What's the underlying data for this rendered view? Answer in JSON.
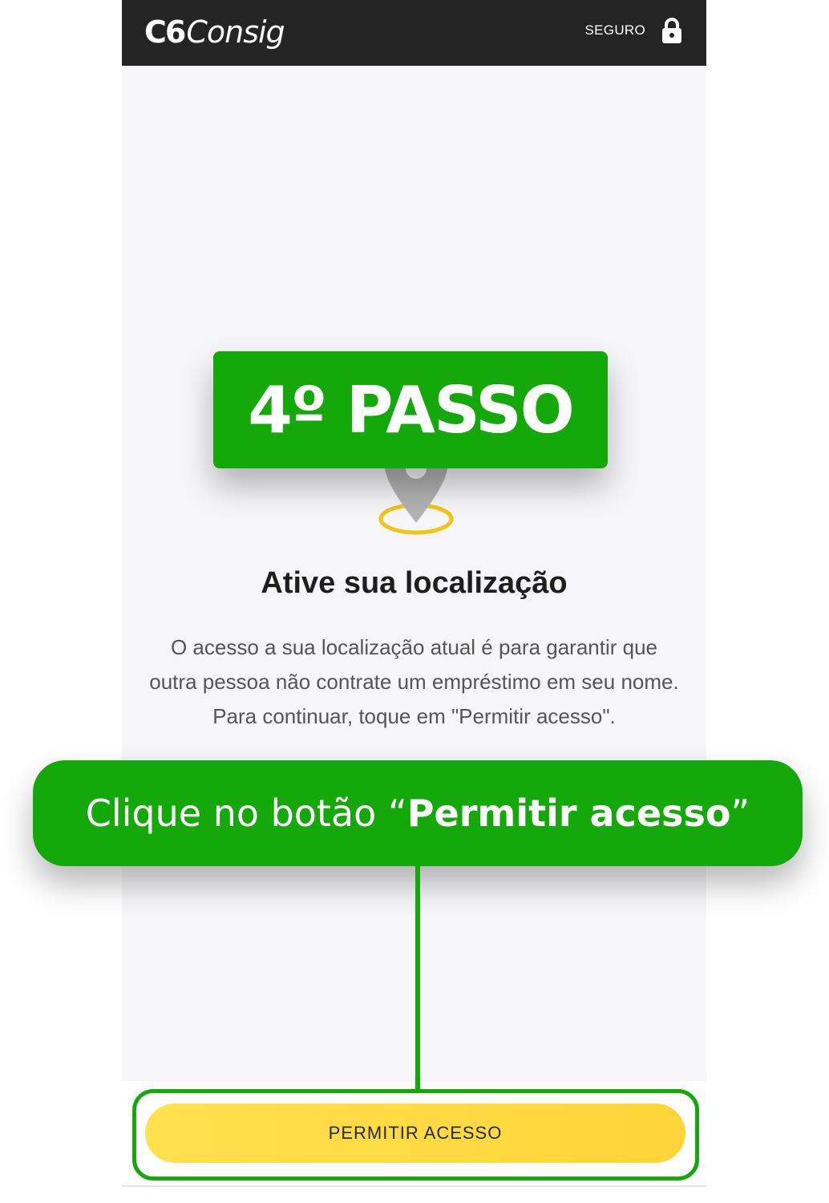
{
  "header": {
    "logo_c6": "C6",
    "logo_consig": "Consig",
    "secure_label": "SEGURO"
  },
  "main": {
    "title": "Ative sua localização",
    "description": "O acesso a sua localização atual é para garantir que outra pessoa não contrate um empréstimo em seu nome. Para continuar, toque em \"Permitir acesso\"."
  },
  "footer": {
    "button_label": "PERMITIR ACESSO"
  },
  "overlay": {
    "step_label": "4º PASSO",
    "callout_prefix": "Clique no botão ",
    "callout_quote_open": "“",
    "callout_bold": "Permitir acesso",
    "callout_quote_close": "”"
  },
  "colors": {
    "header_bg": "#242424",
    "screen_bg": "#f6f6f8",
    "accent_green": "#14a80a",
    "button_yellow": "#ffd538",
    "pin_ring": "#f2c318",
    "pin_gray": "#b3b3b3"
  },
  "icons": {
    "lock": "lock-icon",
    "pin": "location-pin-icon"
  }
}
